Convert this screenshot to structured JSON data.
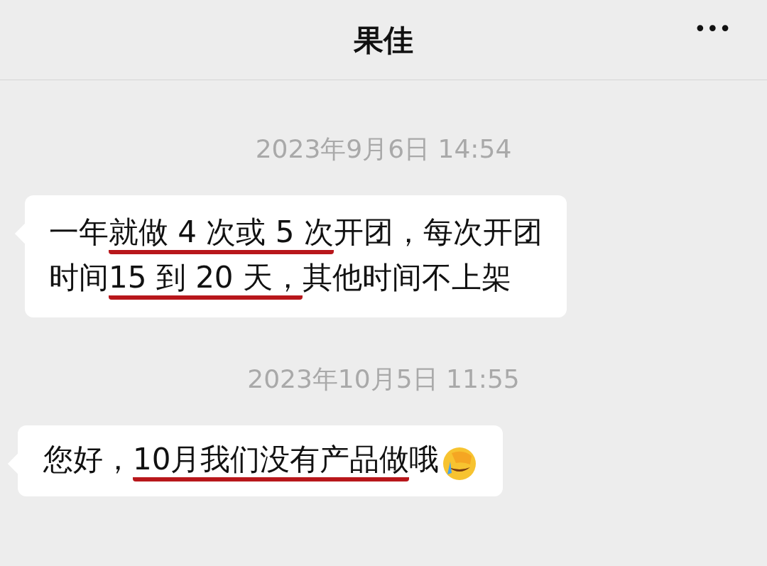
{
  "header": {
    "title": "果佳",
    "menu": "•••"
  },
  "messages": [
    {
      "time": "2023年9月6日 14:54",
      "lines": [
        [
          {
            "text": "一年",
            "underlined": false
          },
          {
            "text": "就做 4 次或 5 次",
            "underlined": true
          },
          {
            "text": "开团，每次开团",
            "underlined": false
          }
        ],
        [
          {
            "text": "时间 ",
            "underlined": false
          },
          {
            "text": "15 到 20 天，",
            "underlined": true
          },
          {
            "text": "其他时间不上架",
            "underlined": false
          }
        ]
      ]
    },
    {
      "time": "2023年10月5日 11:55",
      "emoji": true,
      "lines": [
        [
          {
            "text": "您好，",
            "underlined": false
          },
          {
            "text": "10月我们没有产品做",
            "underlined": true
          },
          {
            "text": "哦",
            "underlined": false
          }
        ]
      ]
    }
  ]
}
